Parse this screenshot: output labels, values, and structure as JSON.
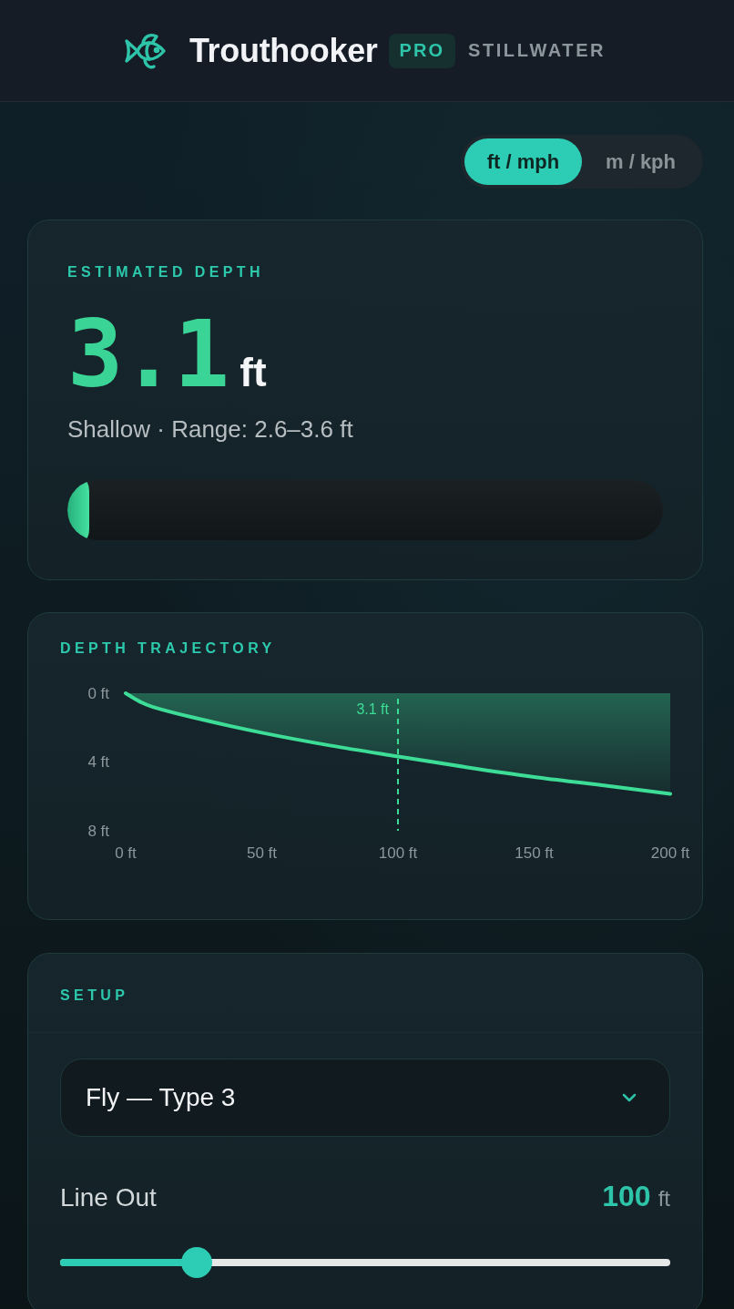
{
  "header": {
    "app_name": "Trouthooker",
    "badge": "PRO",
    "mode": "STILLWATER"
  },
  "unit_options": [
    {
      "label": "ft / mph",
      "selected": true
    },
    {
      "label": "m / kph",
      "selected": false
    }
  ],
  "estimate": {
    "title": "ESTIMATED DEPTH",
    "value": "3.1",
    "unit": "ft",
    "summary": "Shallow · Range: 2.6–3.6 ft",
    "level": 0.037
  },
  "trajectory": {
    "title": "DEPTH TRAJECTORY",
    "chart_data": {
      "type": "area",
      "x": [
        0,
        5,
        10,
        25,
        50,
        75,
        100,
        125,
        150,
        175,
        200
      ],
      "series": [
        {
          "color": "#3ddc97",
          "values": [
            0,
            0.47,
            0.8,
            1.42,
            2.3,
            3.04,
            3.68,
            4.3,
            4.87,
            5.35,
            5.85
          ]
        }
      ],
      "xlim": [
        0,
        200
      ],
      "ylim": [
        8,
        0
      ],
      "xticks": [
        {
          "value": 0,
          "label": "0 ft"
        },
        {
          "value": 50,
          "label": "50 ft"
        },
        {
          "value": 100,
          "label": "100 ft"
        },
        {
          "value": 150,
          "label": "150 ft"
        },
        {
          "value": 200,
          "label": "200 ft"
        }
      ],
      "yticks": [
        {
          "value": 0,
          "label": "0 ft"
        },
        {
          "value": 4,
          "label": "4 ft"
        },
        {
          "value": 8,
          "label": "8 ft"
        }
      ],
      "ref_lines": [
        {
          "axis": "x",
          "value": 100,
          "label": "3.1 ft"
        }
      ]
    }
  },
  "setup": {
    "title": "SETUP",
    "line_type": {
      "value": "Fly — Type 3"
    },
    "line_out": {
      "label": "Line Out",
      "value": "100",
      "unit": "ft",
      "level": 0.224
    }
  }
}
